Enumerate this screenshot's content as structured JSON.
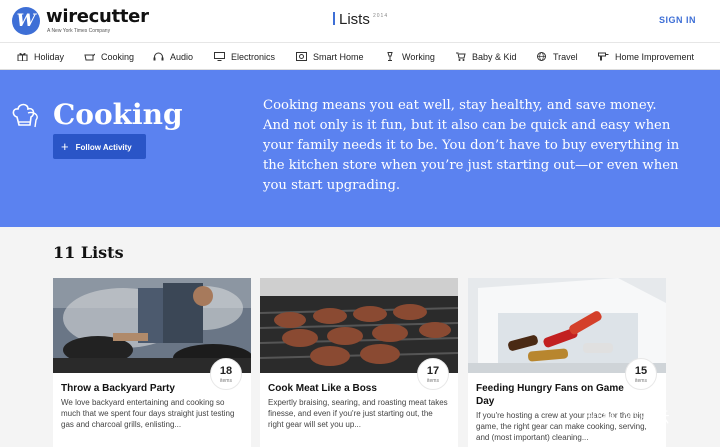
{
  "header": {
    "logo_letter": "W",
    "brand": "wirecutter",
    "brand_sub": "A New York Times Company",
    "lists_label": "Lists",
    "lists_year": "2014",
    "signin_label": "SIGN IN"
  },
  "nav": {
    "categories": [
      {
        "label": "Holiday",
        "icon": "gift-icon"
      },
      {
        "label": "Cooking",
        "icon": "pot-icon"
      },
      {
        "label": "Audio",
        "icon": "headphones-icon"
      },
      {
        "label": "Electronics",
        "icon": "monitor-icon"
      },
      {
        "label": "Smart Home",
        "icon": "smart-home-icon"
      },
      {
        "label": "Working",
        "icon": "lamp-icon"
      },
      {
        "label": "Baby & Kid",
        "icon": "stroller-icon"
      },
      {
        "label": "Travel",
        "icon": "globe-icon"
      },
      {
        "label": "Home Improvement",
        "icon": "drill-icon"
      }
    ]
  },
  "hero": {
    "icon": "chef-hat-icon",
    "title": "Cooking",
    "follow_label": "Follow Activity",
    "description": "Cooking means you eat well, stay healthy, and save money. And not only is it fun, but it also can be quick and easy when your family needs it to be. You don’t have to buy everything in the kitchen store when you’re just starting out—or even when you start upgrading.",
    "background_color": "#5b82f0"
  },
  "lists": {
    "count_title": "11 Lists",
    "items_label": "items",
    "cards": [
      {
        "title": "Throw a Backyard Party",
        "count": "18",
        "description": "We love backyard entertaining and cooking so much that we spent four days straight just testing gas and charcoal grills, enlisting...",
        "image": "people-grilling"
      },
      {
        "title": "Cook Meat Like a Boss",
        "count": "17",
        "description": "Expertly braising, searing, and roasting meat takes finesse, and even if you're just starting out, the right gear will set you up...",
        "image": "burgers-on-grill"
      },
      {
        "title": "Feeding Hungry Fans on Game Day",
        "count": "15",
        "description": "If you're hosting a crew at your place for the big game, the right gear can make cooking, serving, and (most important) cleaning...",
        "image": "cooler-with-drinks"
      }
    ]
  },
  "watermark": "知乎 @白云",
  "colors": {
    "accent": "#3e6fd6",
    "follow_button": "#2a55c7"
  }
}
